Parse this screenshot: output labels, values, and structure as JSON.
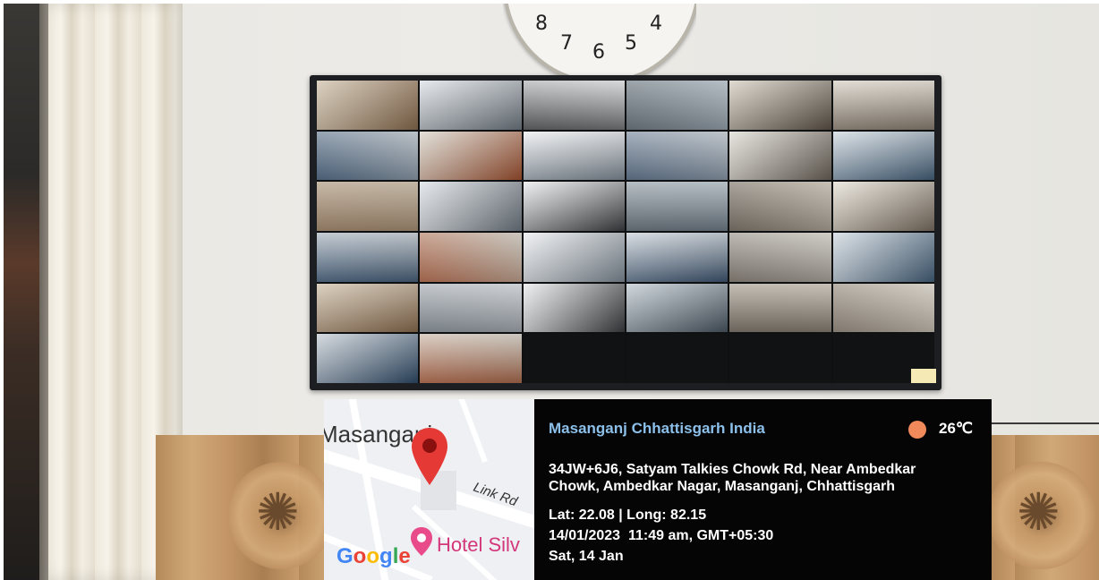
{
  "overlay": {
    "map": {
      "area_label": "Masanganj",
      "road_label": "Link Rd",
      "poi_label": "Hotel Silv",
      "brand": "Google"
    },
    "location_title": "Masanganj Chhattisgarh India",
    "temperature": "26℃",
    "address_line_1": "34JW+6J6, Satyam Talkies Chowk Rd, Near Ambedkar",
    "address_line_2": "Chowk, Ambedkar Nagar, Masanganj, Chhattisgarh",
    "coordinates": "Lat: 22.08 | Long: 82.15",
    "datetime": "14/01/2023  11:49 am, GMT+05:30",
    "day": "Sat, 14 Jan"
  },
  "clock": {
    "numerals": [
      "8",
      "7",
      "6",
      "5",
      "4"
    ]
  },
  "colors": {
    "location_title": "#8cc0ea",
    "temp_dot": "#f08a5a",
    "overlay_bg": "#050505"
  },
  "icons": [
    "map-pin-icon",
    "temperature-dot-icon",
    "google-pin-icon"
  ]
}
